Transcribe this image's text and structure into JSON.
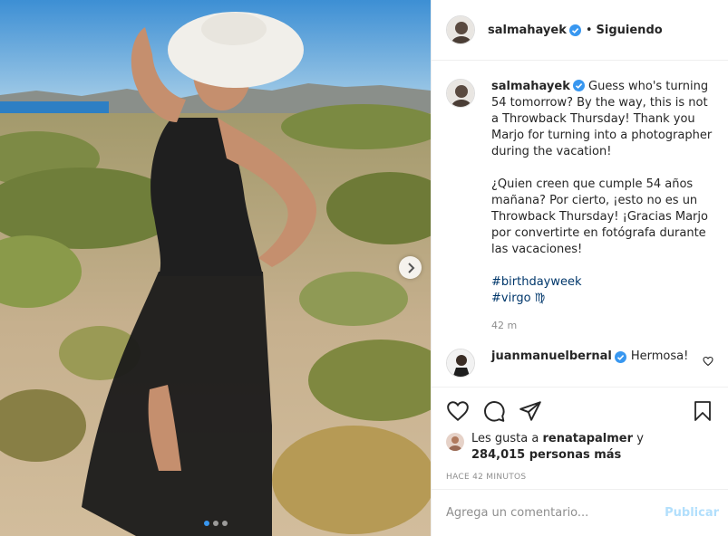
{
  "post": {
    "author": "salmahayek",
    "separator": "•",
    "follow_status": "Siguiendo",
    "caption_en": "Guess who's turning 54 tomorrow? By the way, this is not a Throwback Thursday! Thank you Marjo for turning into a photographer during the vacation!",
    "caption_es": "¿Quien creen que cumple 54 años mañana? Por cierto, ¡esto no es un Throwback Thursday! ¡Gracias Marjo por convertirte en fotógrafa durante las vacaciones!",
    "hashtags": [
      "#birthdayweek",
      "#virgo ♍"
    ],
    "caption_time": "42 m",
    "carousel_dots": 3,
    "active_dot": 0
  },
  "comments": [
    {
      "author": "juanmanuelbernal",
      "text": "Hermosa!"
    }
  ],
  "likes": {
    "prefix": "Les gusta a",
    "user": "renatapalmer",
    "conjunction": "y",
    "count": "284,015 personas más"
  },
  "timestamp": "HACE 42 MINUTOS",
  "add_comment": {
    "placeholder": "Agrega un comentario...",
    "publish_label": "Publicar"
  },
  "icons": {
    "like": "heart-icon",
    "comment": "comment-icon",
    "share": "share-icon",
    "save": "bookmark-icon",
    "verified": "verified-badge-icon",
    "next": "chevron-right-icon"
  },
  "colors": {
    "verified": "#3897f0",
    "hashtag": "#00376b",
    "publish_disabled": "#b2dffc",
    "muted": "#8e8e8e"
  }
}
